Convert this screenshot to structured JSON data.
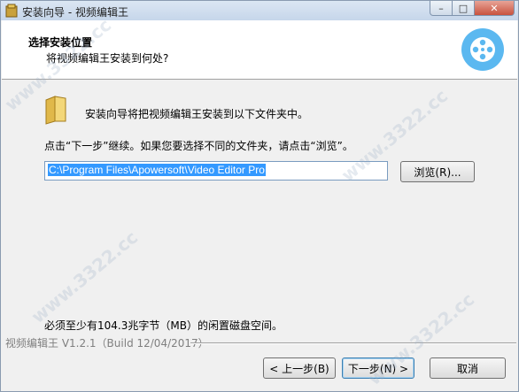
{
  "window": {
    "title": "安装向导 - 视频编辑王"
  },
  "titlebar": {
    "min_glyph": "–",
    "max_glyph": "□",
    "close_glyph": "✕"
  },
  "header": {
    "title": "选择安装位置",
    "subtitle": "将视频编辑王安装到何处?"
  },
  "body": {
    "intro": "安装向导将把视频编辑王安装到以下文件夹中。",
    "instruction": "点击“下一步”继续。如果您要选择不同的文件夹，请点击“浏览”。",
    "path_value": "C:\\Program Files\\Apowersoft\\Video Editor Pro",
    "browse_label": "浏览(R)...",
    "space_required": "必须至少有104.3兆字节（MB）的闲置磁盘空间。"
  },
  "footer": {
    "version": "视频编辑王 V1.2.1（Build 12/04/2017）",
    "back_label": "< 上一步(B)",
    "next_label": "下一步(N) >",
    "cancel_label": "取消"
  },
  "watermark": "www.3322.cc",
  "colors": {
    "accent": "#3399ff",
    "logo": "#5bb8f0"
  }
}
